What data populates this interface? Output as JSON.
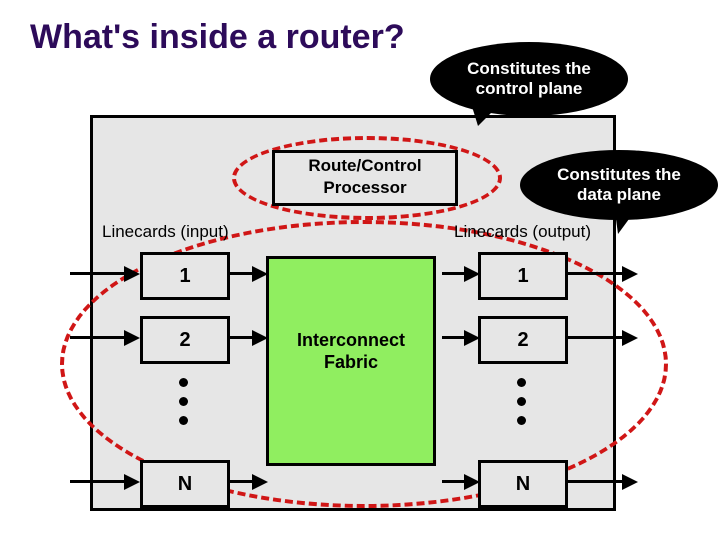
{
  "title": "What's inside a router?",
  "processor": "Route/Control\nProcessor",
  "fabric": "Interconnect\nFabric",
  "labels": {
    "input": "Linecards (input)",
    "output": "Linecards (output)"
  },
  "cards": {
    "first": "1",
    "second": "2",
    "last": "N"
  },
  "bubbles": {
    "control": "Constitutes the\ncontrol plane",
    "data": "Constitutes the\ndata plane"
  }
}
